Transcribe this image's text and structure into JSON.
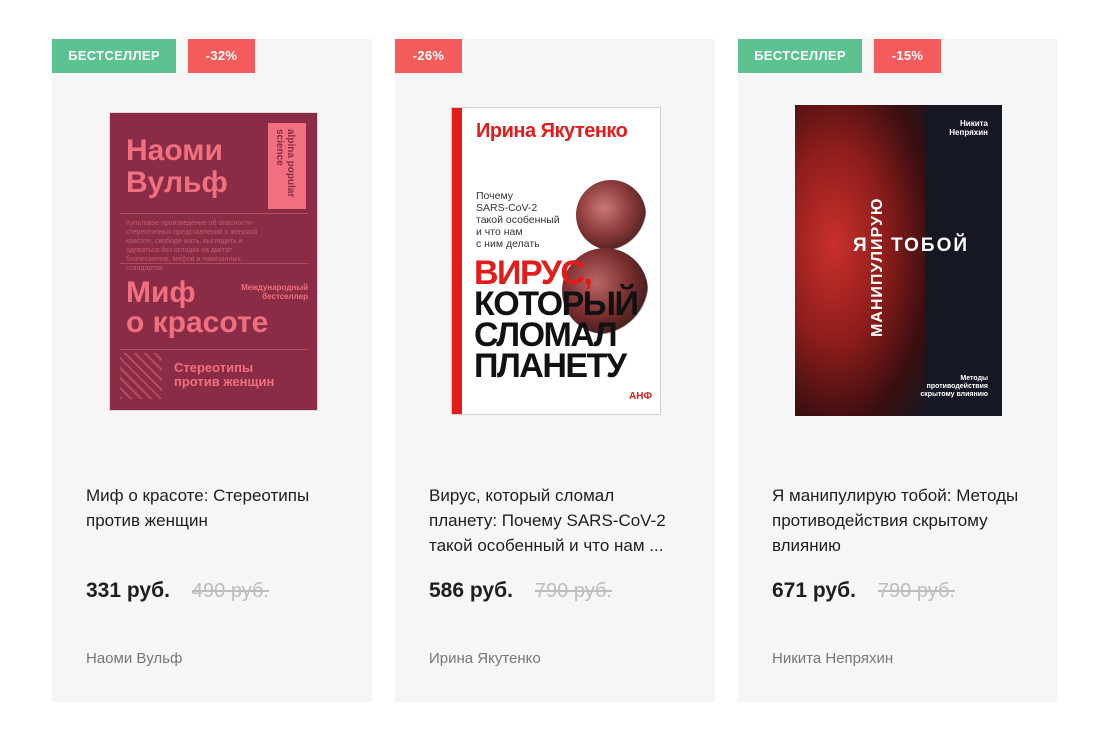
{
  "products": [
    {
      "badges": {
        "bestseller": "БЕСТСЕЛЛЕР",
        "discount": "-32%"
      },
      "title": "Миф о красоте: Стереотипы против женщин",
      "price": "331 руб.",
      "old_price": "490 руб.",
      "author": "Наоми Вульф",
      "cover": {
        "author_line1": "Наоми",
        "author_line2": "Вульф",
        "series": "alpina popular science",
        "blurb": "Культовое произведение об опасности стереотипных представлений о женской красоте, свободе жить, выглядеть и одеваться без оглядки на диктат бизнесменов, мифов и навязанных стандартов",
        "tag": "Международный бестселлер",
        "title_line1": "Миф",
        "title_line2": "о красоте",
        "subtitle_line1": "Стереотипы",
        "subtitle_line2": "против женщин"
      }
    },
    {
      "badges": {
        "bestseller": "",
        "discount": "-26%"
      },
      "title": "Вирус, который сломал планету: Почему SARS-CoV-2 такой особенный и что нам ...",
      "price": "586 руб.",
      "old_price": "790 руб.",
      "author": "Ирина Якутенко",
      "cover": {
        "author": "Ирина Якутенко",
        "question_1": "Почему",
        "question_2": "SARS-CoV-2",
        "question_3": "такой особенный",
        "question_4": "и что нам",
        "question_5": "с ним делать",
        "title_1": "ВИРУС,",
        "title_2": "КОТОРЫЙ",
        "title_3": "СЛОМАЛ",
        "title_4": "ПЛАНЕТУ",
        "publisher": "АНФ"
      }
    },
    {
      "badges": {
        "bestseller": "БЕСТСЕЛЛЕР",
        "discount": "-15%"
      },
      "title": "Я манипулирую тобой: Методы противодействия скрытому влиянию",
      "price": "671 руб.",
      "old_price": "790 руб.",
      "author": "Никита Непряхин",
      "cover": {
        "author_1": "Никита",
        "author_2": "Непряхин",
        "word_i": "Я",
        "word_manip": "МАНИПУЛИРУЮ",
        "word_you": "ТОБОЙ",
        "subtitle_1": "Методы",
        "subtitle_2": "противодействия",
        "subtitle_3": "скрытому влиянию"
      }
    }
  ],
  "colors": {
    "bestseller_badge": "#5cc28f",
    "discount_badge": "#f45b5b",
    "card_bg": "#f5f6f5",
    "old_price": "#bdbdbd",
    "author_text": "#777777"
  }
}
